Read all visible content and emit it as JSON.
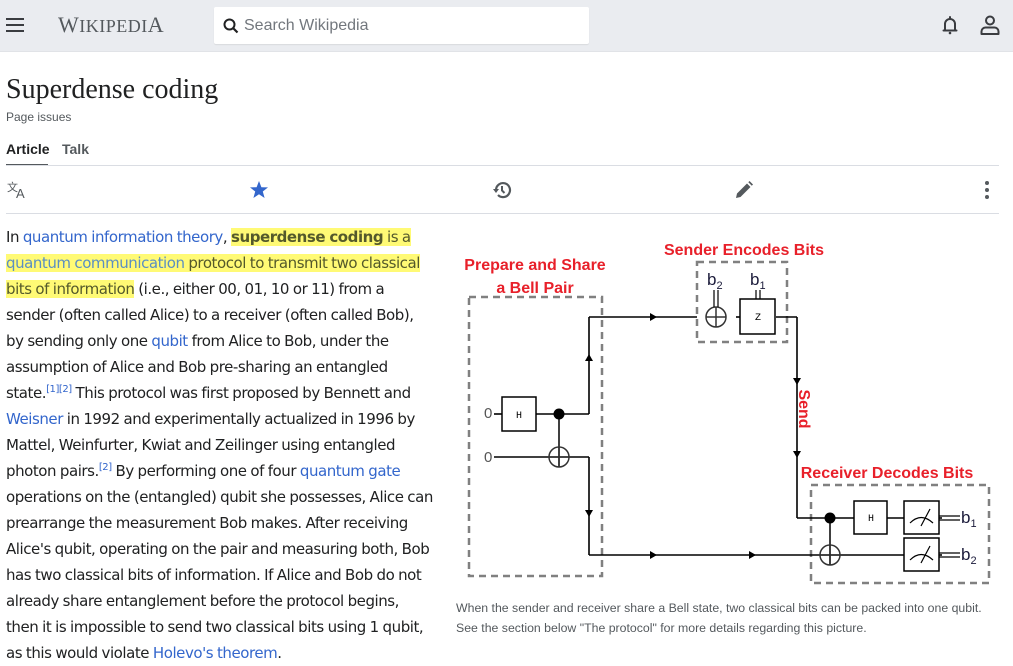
{
  "header": {
    "menu_icon": "hamburger-menu-icon",
    "logo_text": "Wikipedia",
    "logo_first": "W",
    "logo_rest": "IKIPEDI",
    "logo_last": "A",
    "search_placeholder": "Search Wikipedia",
    "search_value": "",
    "notifications_icon": "bell-icon",
    "user_icon": "user-icon"
  },
  "page": {
    "title": "Superdense coding",
    "page_issues": "Page issues",
    "tabs": [
      {
        "label": "Article",
        "active": true
      },
      {
        "label": "Talk",
        "active": false
      }
    ],
    "toolbar": [
      {
        "icon": "language-icon",
        "label": "Language"
      },
      {
        "icon": "star-icon",
        "label": "Watch",
        "color": "#3366cc"
      },
      {
        "icon": "history-icon",
        "label": "History"
      },
      {
        "icon": "pencil-icon",
        "label": "Edit"
      },
      {
        "icon": "more-vertical-icon",
        "label": "More"
      }
    ]
  },
  "article": {
    "highlight_color": "#fff957",
    "link_color": "#3366cc",
    "p1": {
      "s1": "In ",
      "link_qit": "quantum information theory",
      "s2": ", ",
      "bold": "superdense coding",
      "s3": " is a",
      "link_qc": "quantum communication",
      "s4": " protocol to transmit two classical",
      "s5": "bits of information",
      "s6": " (i.e., either 00, 01, 10 or 11) from a",
      "l4": "sender (often called Alice) to a receiver (often called Bob),",
      "l5a": "by sending only one ",
      "link_qubit": "qubit",
      "l5b": " from Alice to Bob, under the",
      "l6": "assumption of Alice and Bob pre-sharing an entangled",
      "l7a": "state.",
      "ref1": "[1]",
      "ref2": "[2]",
      "l7b": " This protocol was first proposed by Bennett and",
      "link_weisner": "Weisner",
      "l8b": " in 1992 and experimentally actualized in 1996 by",
      "l9": "Mattel, Weinfurter, Kwiat and Zeilinger using entangled",
      "l10a": "photon pairs.",
      "ref3": "[2]",
      "l10b": " By performing one of four ",
      "link_qgate": "quantum gate",
      "l11": "operations on the (entangled) qubit she possesses, Alice can",
      "l12": "prearrange the measurement Bob makes. After receiving",
      "l13": "Alice's qubit, operating on the pair and measuring both, Bob",
      "l14": "has two classical bits of information. If Alice and Bob do not",
      "l15": "already share entanglement before the protocol begins,",
      "l16": "then it is impossible to send two classical bits using 1 qubit,",
      "l17a": "as this would violate ",
      "link_holevo": "Holevo's theorem",
      "l17b": "."
    }
  },
  "figure": {
    "label_prepare_1": "Prepare and Share",
    "label_prepare_2": "a Bell Pair",
    "label_sender": "Sender Encodes Bits",
    "label_send": "Send",
    "label_receiver": "Receiver Decodes Bits",
    "label_color": "#e8202a",
    "input_0a": "0",
    "input_0b": "0",
    "gate_h1": "H",
    "gate_z": "Z",
    "gate_h2": "H",
    "bit_b": "b",
    "sub_1": "1",
    "sub_2": "2",
    "caption_1": "When the sender and receiver share a Bell state, two classical bits can be packed into one qubit.",
    "caption_2": "See the section below \"The protocol\" for more details regarding this picture."
  }
}
